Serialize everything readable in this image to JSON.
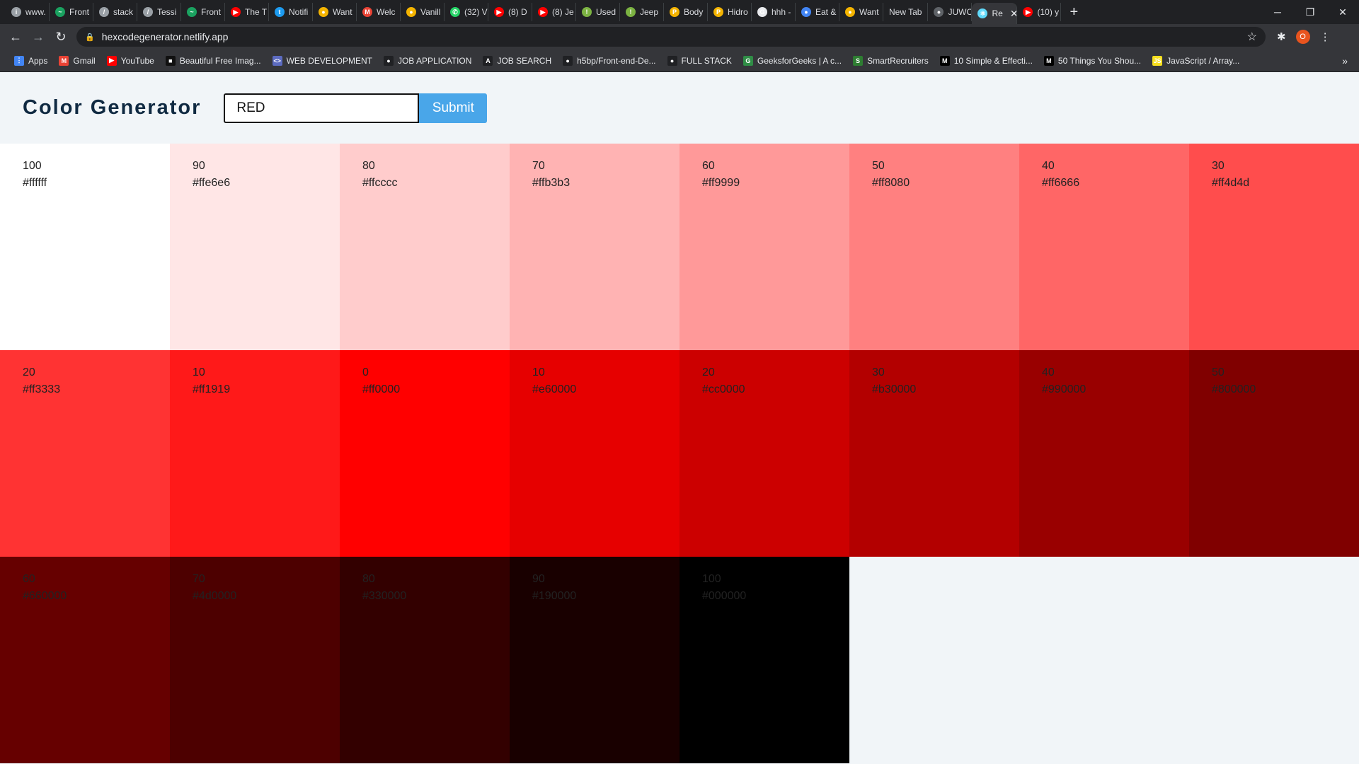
{
  "browser": {
    "tabs": [
      {
        "label": "www.",
        "fav": "#9aa0a6",
        "glyph": "i"
      },
      {
        "label": "Front",
        "fav": "#1aa260",
        "glyph": "~"
      },
      {
        "label": "stack",
        "fav": "#9aa0a6",
        "glyph": "/"
      },
      {
        "label": "Tessi",
        "fav": "#9aa0a6",
        "glyph": "/"
      },
      {
        "label": "Front",
        "fav": "#1aa260",
        "glyph": "~"
      },
      {
        "label": "The T",
        "fav": "#ff0000",
        "glyph": "▶"
      },
      {
        "label": "Notifi",
        "fav": "#1d9bf0",
        "glyph": "t"
      },
      {
        "label": "Want",
        "fav": "#f4b400",
        "glyph": "●"
      },
      {
        "label": "Welc",
        "fav": "#ea4335",
        "glyph": "M"
      },
      {
        "label": "Vanill",
        "fav": "#f4b400",
        "glyph": "●"
      },
      {
        "label": "(32) V",
        "fav": "#25d366",
        "glyph": "✆"
      },
      {
        "label": "(8) D",
        "fav": "#ff0000",
        "glyph": "▶"
      },
      {
        "label": "(8) Je",
        "fav": "#ff0000",
        "glyph": "▶"
      },
      {
        "label": "Used",
        "fav": "#7cb342",
        "glyph": "!"
      },
      {
        "label": "Jeep",
        "fav": "#7cb342",
        "glyph": "!"
      },
      {
        "label": "Body",
        "fav": "#f4b400",
        "glyph": "P"
      },
      {
        "label": "Hidro",
        "fav": "#f4b400",
        "glyph": "P"
      },
      {
        "label": "hhh -",
        "fav": "#e8eaed",
        "glyph": "G"
      },
      {
        "label": "Eat &",
        "fav": "#4285f4",
        "glyph": "●"
      },
      {
        "label": "Want",
        "fav": "#f4b400",
        "glyph": "●"
      },
      {
        "label": "New Tab",
        "fav": "",
        "glyph": ""
      },
      {
        "label": "JUWC",
        "fav": "#5f6368",
        "glyph": "●"
      },
      {
        "label": "Re",
        "fav": "#61dafb",
        "glyph": "⚛",
        "active": true
      },
      {
        "label": "(10) y",
        "fav": "#ff0000",
        "glyph": "▶"
      }
    ],
    "address": "hexcodegenerator.netlify.app",
    "profile_initial": "O",
    "bookmarks": [
      {
        "label": "Apps",
        "color": "#4285f4",
        "glyph": "⋮"
      },
      {
        "label": "Gmail",
        "color": "#ea4335",
        "glyph": "M"
      },
      {
        "label": "YouTube",
        "color": "#ff0000",
        "glyph": "▶"
      },
      {
        "label": "Beautiful Free Imag...",
        "color": "#111111",
        "glyph": "■"
      },
      {
        "label": "WEB DEVELOPMENT",
        "color": "#5c6bc0",
        "glyph": "<>"
      },
      {
        "label": "JOB APPLICATION",
        "color": "#202124",
        "glyph": "●"
      },
      {
        "label": "JOB SEARCH",
        "color": "#202124",
        "glyph": "A"
      },
      {
        "label": "h5bp/Front-end-De...",
        "color": "#202124",
        "glyph": "●"
      },
      {
        "label": "FULL STACK",
        "color": "#202124",
        "glyph": "●"
      },
      {
        "label": "GeeksforGeeks | A c...",
        "color": "#2f8d46",
        "glyph": "G"
      },
      {
        "label": "SmartRecruiters",
        "color": "#2e7d32",
        "glyph": "S"
      },
      {
        "label": "10 Simple & Effecti...",
        "color": "#000000",
        "glyph": "M"
      },
      {
        "label": "50 Things You Shou...",
        "color": "#000000",
        "glyph": "M"
      },
      {
        "label": "JavaScript / Array...",
        "color": "#f7df1e",
        "glyph": "JS"
      }
    ]
  },
  "app": {
    "title": "Color Generator",
    "input_value": "RED",
    "submit_label": "Submit"
  },
  "swatches": [
    {
      "pct": "100",
      "hex": "#ffffff",
      "light": true
    },
    {
      "pct": "90",
      "hex": "#ffe6e6",
      "light": true
    },
    {
      "pct": "80",
      "hex": "#ffcccc",
      "light": true
    },
    {
      "pct": "70",
      "hex": "#ffb3b3",
      "light": true
    },
    {
      "pct": "60",
      "hex": "#ff9999",
      "light": true
    },
    {
      "pct": "50",
      "hex": "#ff8080",
      "light": true
    },
    {
      "pct": "40",
      "hex": "#ff6666",
      "light": true
    },
    {
      "pct": "30",
      "hex": "#ff4d4d",
      "light": true
    },
    {
      "pct": "20",
      "hex": "#ff3333",
      "light": true
    },
    {
      "pct": "10",
      "hex": "#ff1919",
      "light": true
    },
    {
      "pct": "0",
      "hex": "#ff0000",
      "light": false
    },
    {
      "pct": "10",
      "hex": "#e60000",
      "light": false
    },
    {
      "pct": "20",
      "hex": "#cc0000",
      "light": false
    },
    {
      "pct": "30",
      "hex": "#b30000",
      "light": false
    },
    {
      "pct": "40",
      "hex": "#990000",
      "light": false
    },
    {
      "pct": "50",
      "hex": "#800000",
      "light": false
    },
    {
      "pct": "60",
      "hex": "#660000",
      "light": false
    },
    {
      "pct": "70",
      "hex": "#4d0000",
      "light": false
    },
    {
      "pct": "80",
      "hex": "#330000",
      "light": false
    },
    {
      "pct": "90",
      "hex": "#190000",
      "light": false
    },
    {
      "pct": "100",
      "hex": "#000000",
      "light": false
    }
  ],
  "colors": {
    "swatch_text": "#222222",
    "title": "#102a42",
    "submit_bg": "#49a6e9"
  }
}
